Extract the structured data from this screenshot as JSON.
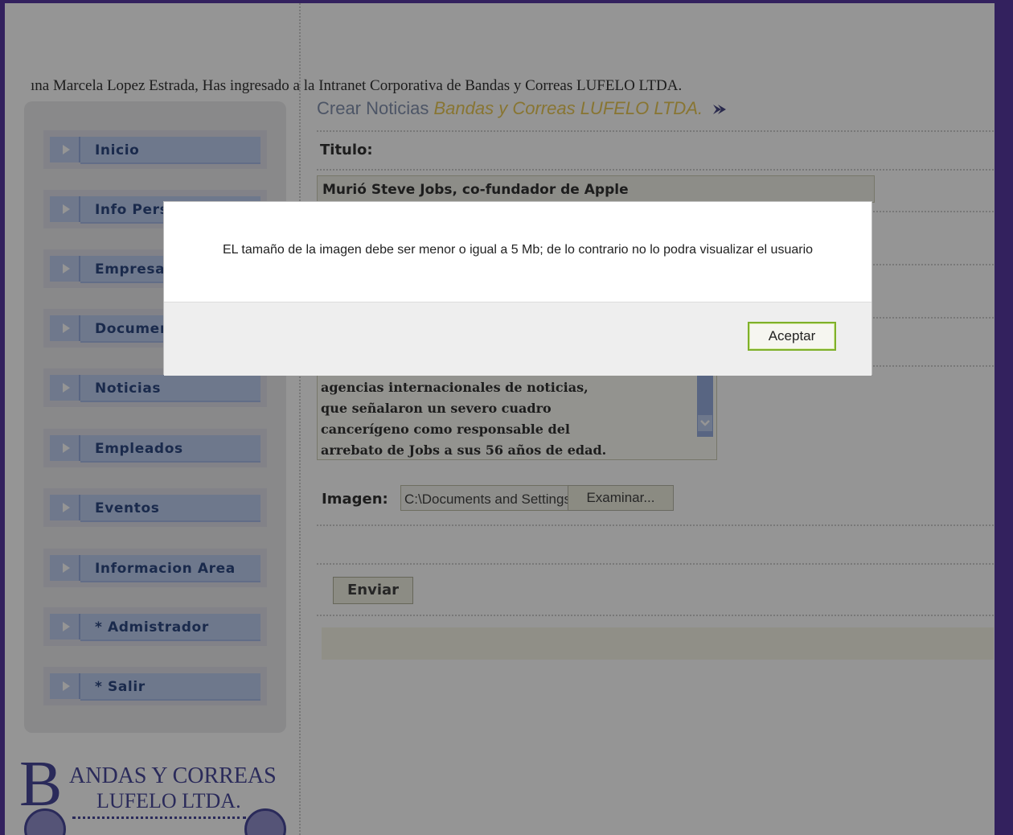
{
  "header": {
    "welcome": "ına Marcela Lopez Estrada, Has ingresado a la Intranet Corporativa de Bandas y Correas LUFELO LTDA."
  },
  "sidebar": {
    "items": [
      {
        "label": "Inicio"
      },
      {
        "label": "Info Personal"
      },
      {
        "label": "Empresa"
      },
      {
        "label": "Documentos"
      },
      {
        "label": "Noticias"
      },
      {
        "label": "Empleados"
      },
      {
        "label": "Eventos"
      },
      {
        "label": "Informacion Area"
      },
      {
        "label": "* Admistrador"
      },
      {
        "label": "* Salir"
      }
    ]
  },
  "logo": {
    "letter": "B",
    "line1": "ANDAS Y CORREAS",
    "line2": "LUFELO LTDA."
  },
  "main": {
    "title_part1": "Crear Noticias",
    "title_part2": "Bandas y Correas LUFELO LTDA.",
    "titulo_label": "Titulo:",
    "titulo_value": "Murió Steve Jobs, co-fundador de Apple",
    "body_lines": [
      "agencias internacionales de noticias,",
      "que señalaron un severo cuadro",
      "cancerígeno como responsable del",
      "arrebato de Jobs a sus 56 años de edad."
    ],
    "imagen_label": "Imagen:",
    "file_value": "C:\\Documents and Settings",
    "browse_label": "Examinar...",
    "send_label": "Enviar"
  },
  "dialog": {
    "message": "EL tamaño de la imagen debe ser menor o igual a 5 Mb; de lo contrario no lo podra visualizar el usuario",
    "accept_label": "Aceptar"
  },
  "colors": {
    "outer_border": "#4a2a9a",
    "nav_button": "#b8c9ef",
    "title_accent": "#e8c448",
    "dialog_button_border": "#7fb02a"
  }
}
